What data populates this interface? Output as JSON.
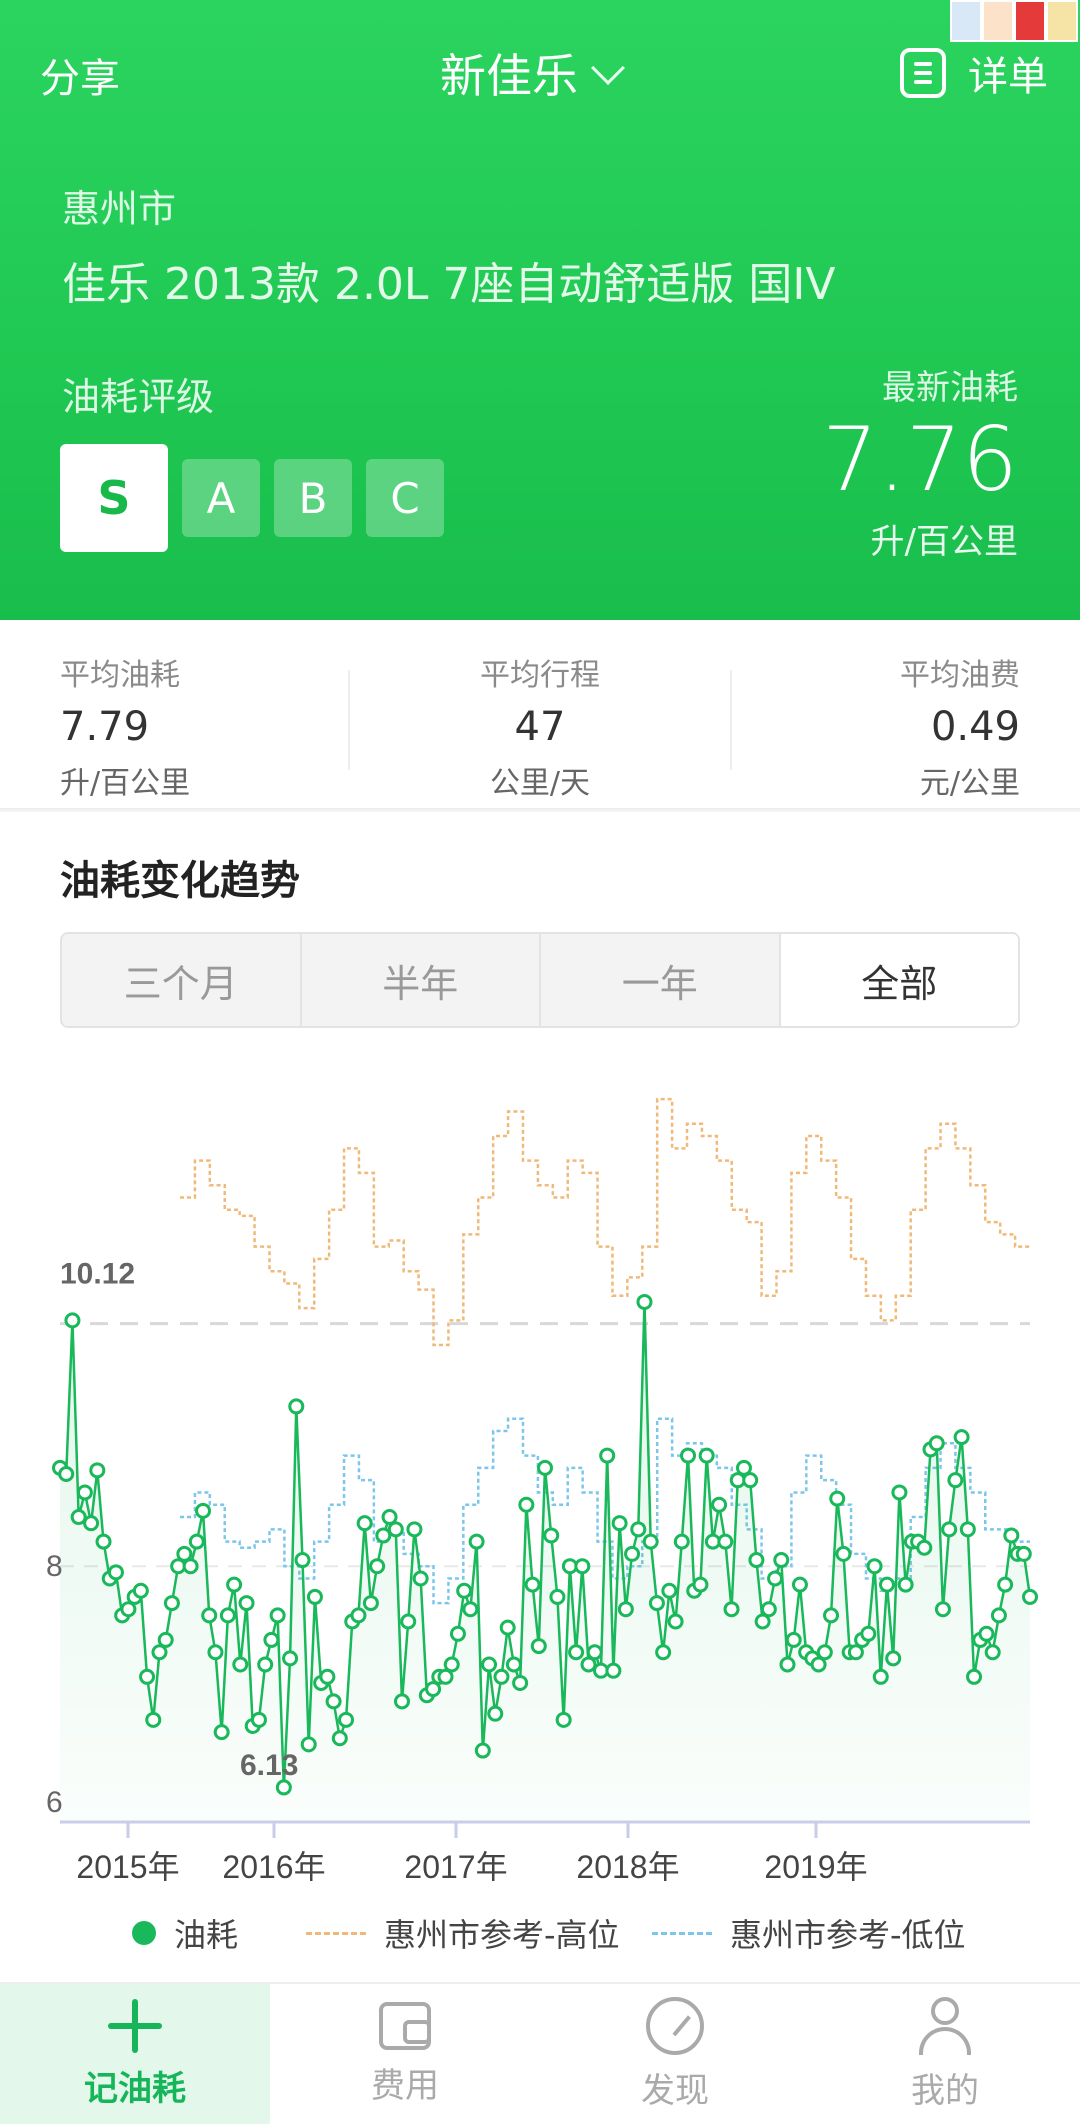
{
  "header": {
    "share_label": "分享",
    "title": "新佳乐",
    "detail_label": "详单"
  },
  "car": {
    "city": "惠州市",
    "model": "佳乐 2013款 2.0L 7座自动舒适版 国IV"
  },
  "rating": {
    "label": "油耗评级",
    "grades": [
      "S",
      "A",
      "B",
      "C"
    ],
    "active": "S"
  },
  "latest": {
    "label": "最新油耗",
    "value": "7.76",
    "unit": "升/百公里"
  },
  "stats": [
    {
      "label": "平均油耗",
      "value": "7.79",
      "unit": "升/百公里"
    },
    {
      "label": "平均行程",
      "value": "47",
      "unit": "公里/天"
    },
    {
      "label": "平均油费",
      "value": "0.49",
      "unit": "元/公里"
    }
  ],
  "trend": {
    "title": "油耗变化趋势",
    "tabs": [
      "三个月",
      "半年",
      "一年",
      "全部"
    ],
    "active_tab": "全部"
  },
  "chart_data": {
    "type": "line",
    "x_tick_labels": [
      "2015年",
      "2016年",
      "2017年",
      "2018年",
      "2019年"
    ],
    "y_tick_labels": [
      "8",
      "6"
    ],
    "ylim": [
      6,
      12.2
    ],
    "annotations": {
      "max": "10.12",
      "min": "6.13"
    },
    "legend": [
      "油耗",
      "惠州市参考-高位",
      "惠州市参考-低位"
    ],
    "reference_line": 10.12,
    "series": [
      {
        "name": "油耗",
        "color": "#19b85a",
        "values": [
          8.8,
          8.75,
          10.0,
          8.4,
          8.6,
          8.35,
          8.78,
          8.2,
          7.9,
          7.95,
          7.6,
          7.65,
          7.75,
          7.8,
          7.1,
          6.75,
          7.3,
          7.4,
          7.7,
          8.0,
          8.1,
          8.0,
          8.2,
          8.45,
          7.6,
          7.3,
          6.65,
          7.6,
          7.85,
          7.2,
          7.7,
          6.7,
          6.75,
          7.2,
          7.4,
          7.6,
          6.2,
          7.25,
          9.3,
          8.05,
          6.55,
          7.75,
          7.05,
          7.1,
          6.9,
          6.6,
          6.75,
          7.55,
          7.6,
          8.35,
          7.7,
          8.0,
          8.25,
          8.4,
          8.3,
          6.9,
          7.55,
          8.3,
          7.9,
          6.95,
          7.0,
          7.1,
          7.1,
          7.2,
          7.45,
          7.8,
          7.65,
          8.2,
          6.5,
          7.2,
          6.8,
          7.1,
          7.5,
          7.2,
          7.05,
          8.5,
          7.85,
          7.35,
          8.8,
          8.25,
          7.75,
          6.75,
          8.0,
          7.3,
          8.0,
          7.2,
          7.3,
          7.15,
          8.9,
          7.15,
          8.35,
          7.65,
          8.1,
          8.3,
          10.15,
          8.2,
          7.7,
          7.3,
          7.8,
          7.55,
          8.2,
          8.9,
          7.8,
          7.85,
          8.9,
          8.2,
          8.5,
          8.2,
          7.65,
          8.7,
          8.8,
          8.7,
          8.05,
          7.55,
          7.65,
          7.9,
          8.05,
          7.2,
          7.4,
          7.85,
          7.3,
          7.25,
          7.2,
          7.3,
          7.6,
          8.55,
          8.1,
          7.3,
          7.3,
          7.4,
          7.45,
          8.0,
          7.1,
          7.85,
          7.25,
          8.6,
          7.85,
          8.2,
          8.2,
          8.15,
          8.95,
          9.0,
          7.65,
          8.3,
          8.7,
          9.05,
          8.3,
          7.1,
          7.4,
          7.45,
          7.3,
          7.6,
          7.85,
          8.25,
          8.1,
          8.1,
          7.75
        ]
      },
      {
        "name": "惠州市参考-高位",
        "color": "#f0b97a",
        "values": [
          11.0,
          11.3,
          11.1,
          10.9,
          10.85,
          10.6,
          10.4,
          10.3,
          10.1,
          10.5,
          10.9,
          11.4,
          11.2,
          10.6,
          10.65,
          10.4,
          10.25,
          9.8,
          10.0,
          10.7,
          11.0,
          11.5,
          11.7,
          11.3,
          11.1,
          11.0,
          11.3,
          11.2,
          10.6,
          10.2,
          10.35,
          10.6,
          11.8,
          11.4,
          11.6,
          11.5,
          11.3,
          10.9,
          10.8,
          10.2,
          10.4,
          11.2,
          11.5,
          11.3,
          11.0,
          10.5,
          10.2,
          10.0,
          10.2,
          10.9,
          11.4,
          11.6,
          11.4,
          11.1,
          10.8,
          10.7,
          10.6,
          10.6
        ]
      },
      {
        "name": "惠州市参考-低位",
        "color": "#7cc6ea",
        "values": [
          8.4,
          8.6,
          8.5,
          8.2,
          8.15,
          8.2,
          8.3,
          8.0,
          7.9,
          8.2,
          8.5,
          8.9,
          8.7,
          8.2,
          8.3,
          8.1,
          8.0,
          7.7,
          7.9,
          8.5,
          8.8,
          9.1,
          9.2,
          8.9,
          8.6,
          8.5,
          8.8,
          8.6,
          8.2,
          7.9,
          8.0,
          8.2,
          9.2,
          8.9,
          9.0,
          8.9,
          8.8,
          8.5,
          8.3,
          7.9,
          8.0,
          8.6,
          8.9,
          8.7,
          8.5,
          8.1,
          7.9,
          7.8,
          7.9,
          8.4,
          8.8,
          9.0,
          8.8,
          8.6,
          8.3,
          8.3,
          8.2,
          8.2
        ]
      }
    ]
  },
  "nav": [
    {
      "label": "记油耗"
    },
    {
      "label": "费用"
    },
    {
      "label": "发现"
    },
    {
      "label": "我的"
    }
  ]
}
